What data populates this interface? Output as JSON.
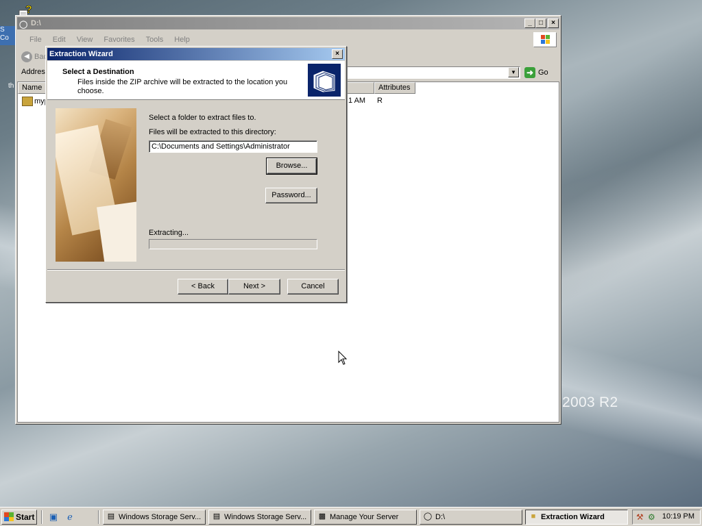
{
  "desktop": {
    "brand_text": "2003 R2",
    "side_text_1": "S Co",
    "side_text_2": "th"
  },
  "explorer": {
    "title": "D:\\",
    "menu": [
      "File",
      "Edit",
      "View",
      "Favorites",
      "Tools",
      "Help"
    ],
    "toolbar_back": "Back",
    "address_label": "Address",
    "go_label": "Go",
    "columns": [
      "Name",
      "Attributes"
    ],
    "row": {
      "name": "myp",
      "modified": "1 AM",
      "attributes": "R"
    }
  },
  "wizard": {
    "title": "Extraction Wizard",
    "header_title": "Select a Destination",
    "header_subtitle": "Files inside the ZIP archive will be extracted to the location you choose.",
    "select_folder_label": "Select a folder to extract files to.",
    "directory_label": "Files will be extracted to this directory:",
    "directory_value": "C:\\Documents and Settings\\Administrator",
    "browse_label": "Browse...",
    "password_label": "Password...",
    "extracting_label": "Extracting...",
    "progress": 0,
    "back_label": "< Back",
    "next_label": "Next >",
    "cancel_label": "Cancel"
  },
  "taskbar": {
    "start_label": "Start",
    "tasks": [
      {
        "label": "Windows Storage Serv...",
        "icon": "window-icon"
      },
      {
        "label": "Windows Storage Serv...",
        "icon": "window-icon"
      },
      {
        "label": "Manage Your Server",
        "icon": "server-icon"
      },
      {
        "label": "D:\\",
        "icon": "drive-icon"
      },
      {
        "label": "Extraction Wizard",
        "icon": "folder-icon"
      }
    ],
    "clock": "10:19 PM"
  },
  "colors": {
    "active_title": "#0a246a",
    "inactive_title": "#808080",
    "face": "#d4d0c8"
  }
}
